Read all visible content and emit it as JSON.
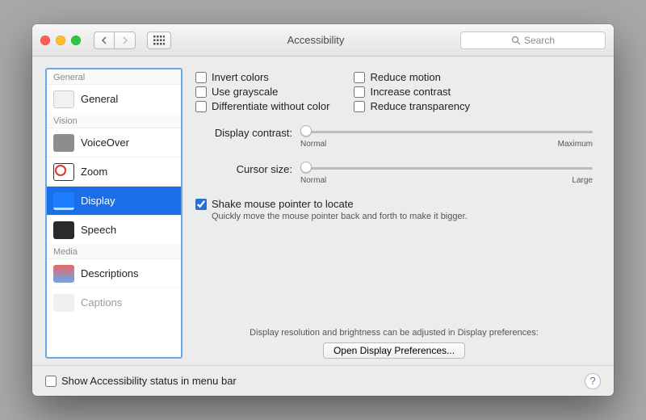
{
  "window": {
    "title": "Accessibility"
  },
  "toolbar": {
    "search_placeholder": "Search"
  },
  "sidebar": {
    "sections": {
      "general": "General",
      "vision": "Vision",
      "media": "Media"
    },
    "items": {
      "general": "General",
      "voiceover": "VoiceOver",
      "zoom": "Zoom",
      "display": "Display",
      "speech": "Speech",
      "descriptions": "Descriptions",
      "captions": "Captions"
    },
    "selected": "display"
  },
  "pane": {
    "checks": {
      "invert": "Invert colors",
      "grayscale": "Use grayscale",
      "diff": "Differentiate without color",
      "motion": "Reduce motion",
      "contrast": "Increase contrast",
      "transparency": "Reduce transparency"
    },
    "sliders": {
      "contrast": {
        "label": "Display contrast:",
        "min": "Normal",
        "max": "Maximum",
        "value_pct": 0
      },
      "cursor": {
        "label": "Cursor size:",
        "min": "Normal",
        "max": "Large",
        "value_pct": 0
      }
    },
    "shake": {
      "label": "Shake mouse pointer to locate",
      "hint": "Quickly move the mouse pointer back and forth to make it bigger.",
      "checked": true
    },
    "note": "Display resolution and brightness can be adjusted in Display preferences:",
    "open_button": "Open Display Preferences..."
  },
  "footer": {
    "menubar": "Show Accessibility status in menu bar"
  }
}
